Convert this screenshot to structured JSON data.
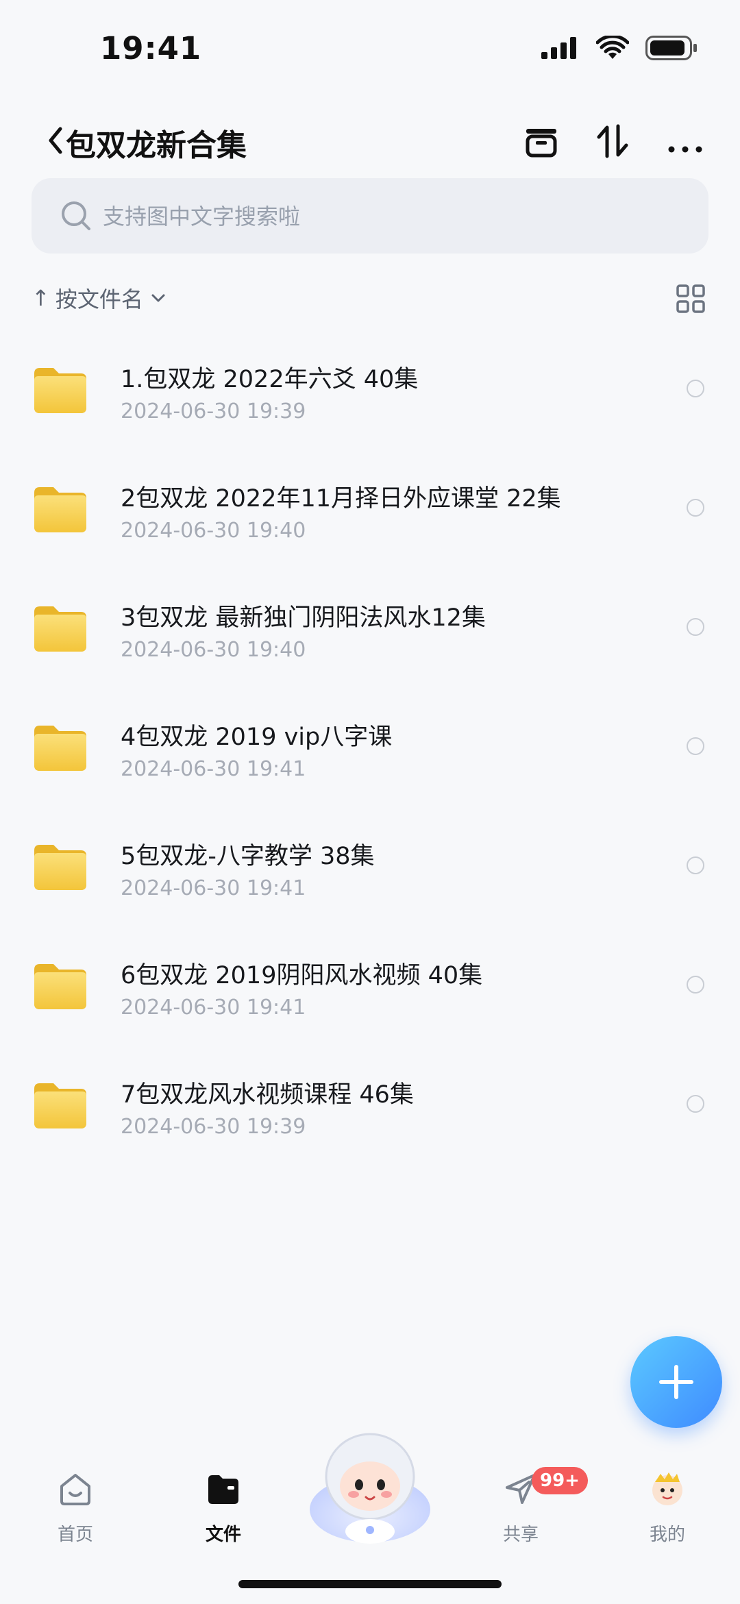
{
  "status_bar": {
    "time": "19:41"
  },
  "header": {
    "title": "包双龙新合集"
  },
  "search": {
    "placeholder": "支持图中文字搜索啦"
  },
  "sort": {
    "arrow": "↑",
    "label": "按文件名"
  },
  "files": [
    {
      "name": "1.包双龙 2022年六爻 40集",
      "date": "2024-06-30 19:39"
    },
    {
      "name": "2包双龙 2022年11月择日外应课堂 22集",
      "date": "2024-06-30 19:40"
    },
    {
      "name": "3包双龙 最新独门阴阳法风水12集",
      "date": "2024-06-30 19:40"
    },
    {
      "name": "4包双龙 2019 vip八字课",
      "date": "2024-06-30 19:41"
    },
    {
      "name": "5包双龙-八字教学 38集",
      "date": "2024-06-30 19:41"
    },
    {
      "name": "6包双龙 2019阴阳风水视频 40集",
      "date": "2024-06-30 19:41"
    },
    {
      "name": "7包双龙风水视频课程 46集",
      "date": "2024-06-30 19:39"
    }
  ],
  "nav": {
    "home": "首页",
    "files": "文件",
    "share": "共享",
    "share_badge": "99+",
    "mine": "我的"
  },
  "colors": {
    "accent": "#3f8bff",
    "folder": "#f6cf4a",
    "badge": "#f45b5b"
  }
}
